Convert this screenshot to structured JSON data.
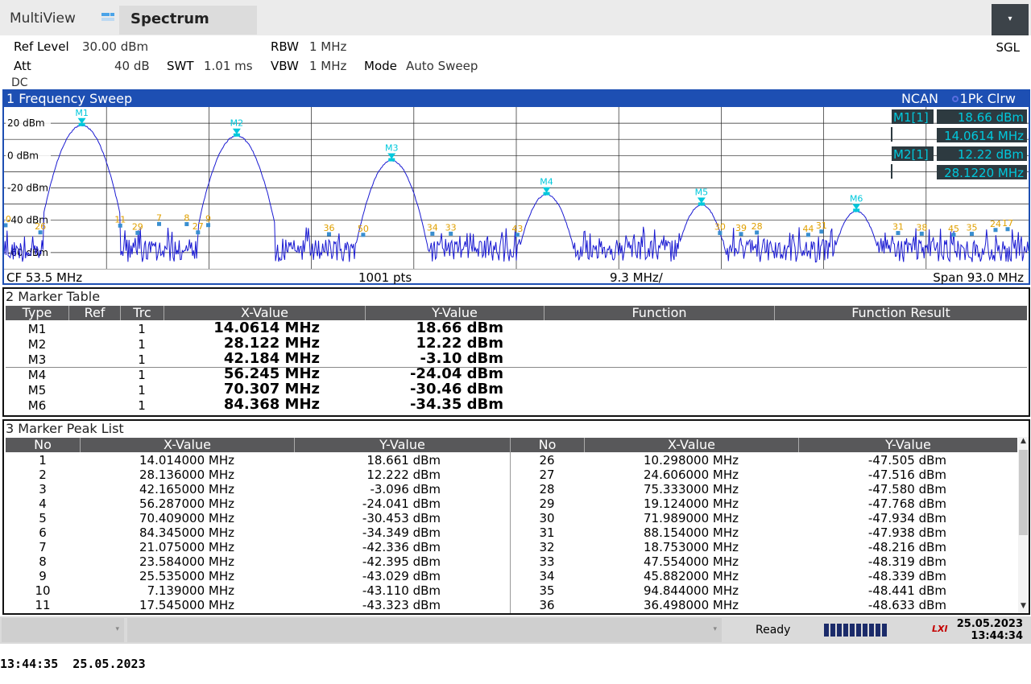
{
  "topbar": {
    "app_title": "MultiView",
    "tab_label": "Spectrum",
    "menu_icon": "▾",
    "mode_label": "SGL"
  },
  "settings": {
    "ref_level_label": "Ref Level",
    "ref_level_value": "30.00 dBm",
    "att_label": "Att",
    "att_value": "40 dB",
    "swt_label": "SWT",
    "swt_value": "1.01 ms",
    "rbw_label": "RBW",
    "rbw_value": "1 MHz",
    "vbw_label": "VBW",
    "vbw_value": "1 MHz",
    "mode_label": "Mode",
    "mode_value": "Auto Sweep",
    "coupling": "DC"
  },
  "colors": {
    "window_blue": "#1d4fb3",
    "trace": "#1a1ad2",
    "marker": "#00c8dc",
    "peak_label": "#e0a000",
    "grid": "#000000"
  },
  "sweep": {
    "title": "1 Frequency Sweep",
    "ncan": "NCAN",
    "trace_label": "1Pk Clrw",
    "y_ticks": [
      "20 dBm",
      "0 dBm",
      "-20 dBm",
      "-40 dBm",
      "-60 dBm"
    ],
    "readout": [
      {
        "name": "M1[1]",
        "value": "18.66 dBm",
        "freq": "14.0614 MHz"
      },
      {
        "name": "M2[1]",
        "value": "12.22 dBm",
        "freq": "28.1220 MHz"
      }
    ],
    "footer": {
      "cf": "CF 53.5 MHz",
      "pts": "1001 pts",
      "div": "9.3 MHz/",
      "span": "Span 93.0 MHz"
    }
  },
  "chart_data": {
    "type": "line",
    "x_unit": "MHz",
    "y_unit": "dBm",
    "xlim": [
      7.0,
      100.0
    ],
    "ylim": [
      -70,
      30
    ],
    "markers": [
      {
        "label": "M1",
        "x": 14.0614,
        "y": 18.66
      },
      {
        "label": "M2",
        "x": 28.122,
        "y": 12.22
      },
      {
        "label": "M3",
        "x": 42.184,
        "y": -3.1
      },
      {
        "label": "M4",
        "x": 56.245,
        "y": -24.04
      },
      {
        "label": "M5",
        "x": 70.307,
        "y": -30.46
      },
      {
        "label": "M6",
        "x": 84.368,
        "y": -34.35
      }
    ],
    "peak_labels": [
      {
        "label": "11",
        "x": 17.545,
        "y": -43.3
      },
      {
        "label": "29",
        "x": 19.124,
        "y": -47.8
      },
      {
        "label": "7",
        "x": 21.075,
        "y": -42.3
      },
      {
        "label": "8",
        "x": 23.584,
        "y": -42.4
      },
      {
        "label": "27",
        "x": 24.606,
        "y": -47.5
      },
      {
        "label": "9",
        "x": 25.535,
        "y": -43.0
      },
      {
        "label": "36",
        "x": 36.498,
        "y": -48.6
      },
      {
        "label": "50",
        "x": 39.6,
        "y": -49.0
      },
      {
        "label": "34",
        "x": 45.882,
        "y": -48.3
      },
      {
        "label": "33",
        "x": 47.554,
        "y": -48.3
      },
      {
        "label": "43",
        "x": 53.6,
        "y": -49.0
      },
      {
        "label": "30",
        "x": 71.989,
        "y": -47.9
      },
      {
        "label": "39",
        "x": 73.9,
        "y": -48.5
      },
      {
        "label": "28",
        "x": 75.333,
        "y": -47.6
      },
      {
        "label": "44",
        "x": 80.0,
        "y": -49.0
      },
      {
        "label": "31",
        "x": 81.2,
        "y": -47.0
      },
      {
        "label": "31",
        "x": 88.154,
        "y": -47.9
      },
      {
        "label": "38",
        "x": 90.3,
        "y": -48.3
      },
      {
        "label": "45",
        "x": 93.2,
        "y": -49.0
      },
      {
        "label": "35",
        "x": 94.844,
        "y": -48.4
      },
      {
        "label": "24",
        "x": 97.0,
        "y": -46.0
      },
      {
        "label": "17",
        "x": 98.1,
        "y": -45.5
      },
      {
        "label": "10",
        "x": 7.139,
        "y": -43.1
      },
      {
        "label": "26",
        "x": 10.298,
        "y": -47.5
      }
    ],
    "noise_floor": -52
  },
  "marker_table": {
    "title": "2 Marker Table",
    "headers": [
      "Type",
      "Ref",
      "Trc",
      "X-Value",
      "Y-Value",
      "Function",
      "Function Result"
    ],
    "rows": [
      {
        "type": "M1",
        "ref": "",
        "trc": "1",
        "x": "14.0614 MHz",
        "y": "18.66 dBm"
      },
      {
        "type": "M2",
        "ref": "",
        "trc": "1",
        "x": "28.122 MHz",
        "y": "12.22 dBm"
      },
      {
        "type": "M3",
        "ref": "",
        "trc": "1",
        "x": "42.184 MHz",
        "y": "-3.10 dBm"
      },
      {
        "type": "M4",
        "ref": "",
        "trc": "1",
        "x": "56.245 MHz",
        "y": "-24.04 dBm"
      },
      {
        "type": "M5",
        "ref": "",
        "trc": "1",
        "x": "70.307 MHz",
        "y": "-30.46 dBm"
      },
      {
        "type": "M6",
        "ref": "",
        "trc": "1",
        "x": "84.368 MHz",
        "y": "-34.35 dBm"
      }
    ]
  },
  "peak_list": {
    "title": "3 Marker Peak List",
    "headers": [
      "No",
      "X-Value",
      "Y-Value",
      "No",
      "X-Value",
      "Y-Value"
    ],
    "left": [
      {
        "no": "1",
        "x": "14.014000 MHz",
        "y": "18.661 dBm"
      },
      {
        "no": "2",
        "x": "28.136000 MHz",
        "y": "12.222 dBm"
      },
      {
        "no": "3",
        "x": "42.165000 MHz",
        "y": "-3.096 dBm"
      },
      {
        "no": "4",
        "x": "56.287000 MHz",
        "y": "-24.041 dBm"
      },
      {
        "no": "5",
        "x": "70.409000 MHz",
        "y": "-30.453 dBm"
      },
      {
        "no": "6",
        "x": "84.345000 MHz",
        "y": "-34.349 dBm"
      },
      {
        "no": "7",
        "x": "21.075000 MHz",
        "y": "-42.336 dBm"
      },
      {
        "no": "8",
        "x": "23.584000 MHz",
        "y": "-42.395 dBm"
      },
      {
        "no": "9",
        "x": "25.535000 MHz",
        "y": "-43.029 dBm"
      },
      {
        "no": "10",
        "x": "7.139000 MHz",
        "y": "-43.110 dBm"
      },
      {
        "no": "11",
        "x": "17.545000 MHz",
        "y": "-43.323 dBm"
      }
    ],
    "right": [
      {
        "no": "26",
        "x": "10.298000 MHz",
        "y": "-47.505 dBm"
      },
      {
        "no": "27",
        "x": "24.606000 MHz",
        "y": "-47.516 dBm"
      },
      {
        "no": "28",
        "x": "75.333000 MHz",
        "y": "-47.580 dBm"
      },
      {
        "no": "29",
        "x": "19.124000 MHz",
        "y": "-47.768 dBm"
      },
      {
        "no": "30",
        "x": "71.989000 MHz",
        "y": "-47.934 dBm"
      },
      {
        "no": "31",
        "x": "88.154000 MHz",
        "y": "-47.938 dBm"
      },
      {
        "no": "32",
        "x": "18.753000 MHz",
        "y": "-48.216 dBm"
      },
      {
        "no": "33",
        "x": "47.554000 MHz",
        "y": "-48.319 dBm"
      },
      {
        "no": "34",
        "x": "45.882000 MHz",
        "y": "-48.339 dBm"
      },
      {
        "no": "35",
        "x": "94.844000 MHz",
        "y": "-48.441 dBm"
      },
      {
        "no": "36",
        "x": "36.498000 MHz",
        "y": "-48.633 dBm"
      }
    ],
    "scroll_up_icon": "▲",
    "scroll_down_icon": "▼"
  },
  "status": {
    "dropdown_icon": "▾",
    "ready": "Ready",
    "lxi": "LXI",
    "date": "25.05.2023",
    "time": "13:44:34"
  },
  "caption": "13:44:35  25.05.2023"
}
